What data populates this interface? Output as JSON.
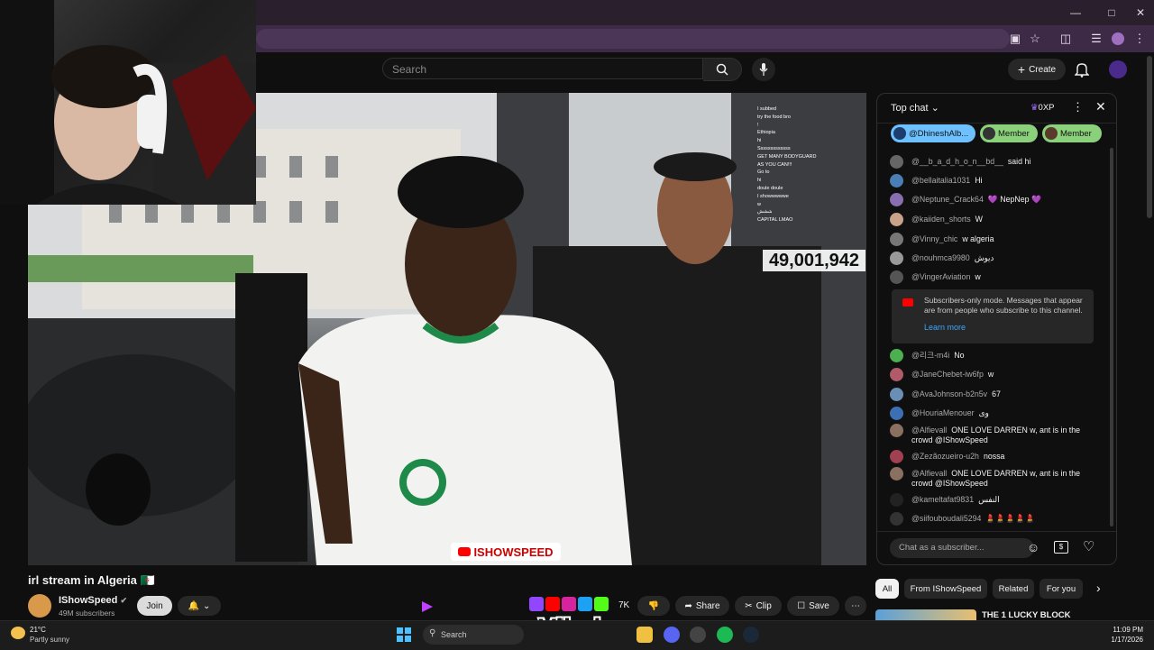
{
  "search": {
    "placeholder": "Search"
  },
  "header": {
    "create_label": "Create"
  },
  "video": {
    "counter": "49,001,942",
    "watermark": "ISHOWSPEED",
    "overlay_chat": [
      "I subbed",
      "try the food bro",
      "!",
      "Ethiopia",
      "hi",
      "Sssssssssssss",
      "",
      "GET MANY BODYGUARD",
      "AS YOU CAN!!!",
      "Go to",
      "hi",
      "doule doule",
      "I showwwwwe",
      "w",
      "ششش",
      "CAPITAL LMAO"
    ]
  },
  "chat": {
    "mode_label": "Top chat",
    "xp_label": "0XP",
    "pills": [
      "@DhineshAlb...",
      "Member",
      "Member"
    ],
    "messages": [
      {
        "author": "@__b_a_d_h_o_n__bd__",
        "text": "said hi",
        "color": "#666"
      },
      {
        "author": "@bellaitalia1031",
        "text": "Hi",
        "color": "#4a7fb5"
      },
      {
        "author": "@Neptune_Crack64",
        "text": "💜 NepNep 💜",
        "color": "#8a6fb0"
      },
      {
        "author": "@kaiiden_shorts",
        "text": "W",
        "color": "#c9a28c"
      },
      {
        "author": "@Vinny_chic",
        "text": "w algeria",
        "color": "#777"
      },
      {
        "author": "@nouhmca9980",
        "text": "ديوش",
        "color": "#999"
      },
      {
        "author": "@VingerAviation",
        "text": "w",
        "color": "#555"
      },
      {
        "author": "@리크-m4i",
        "text": "No",
        "color": "#4caf50"
      },
      {
        "author": "@JaneChebet-iw6fp",
        "text": "w",
        "color": "#b05a6a"
      },
      {
        "author": "@AvaJohnson-b2n5v",
        "text": "67",
        "color": "#6a8fb5"
      },
      {
        "author": "@HouriaMenouer",
        "text": "وى",
        "color": "#3d6fb5"
      },
      {
        "author": "@Alfievall",
        "text": "ONE LOVE DARREN w, ant is in the crowd @IShowSpeed",
        "color": "#8a7060"
      },
      {
        "author": "@Zezãozueiro-u2h",
        "text": "nossa",
        "color": "#a04050"
      },
      {
        "author": "@Alfievall",
        "text": "ONE LOVE DARREN w, ant is in the crowd @IShowSpeed",
        "color": "#8a7060"
      },
      {
        "author": "@kameltafat9831",
        "text": "النفس",
        "color": "#222"
      },
      {
        "author": "@siifouboudali5294",
        "text": "💄💄💄💄💄",
        "color": "#333"
      }
    ],
    "system_message": "Subscribers-only mode. Messages that appear are from people who subscribe to this channel.",
    "learn_more": "Learn more",
    "input_placeholder": "Chat as a subscriber..."
  },
  "below": {
    "title": "irl stream in Algeria 🇩🇿",
    "channel_name": "IShowSpeed",
    "subscribers": "49M subscribers",
    "join_label": "Join",
    "likes": "7K",
    "share_label": "Share",
    "clip_label": "Clip",
    "save_label": "Save",
    "logo_text": "Vibzlo"
  },
  "chips": [
    "All",
    "From IShowSpeed",
    "Related",
    "For you"
  ],
  "recommended": {
    "title": "THE 1 LUCKY BLOCK"
  },
  "taskbar": {
    "temperature": "21°C",
    "weather": "Partly sunny",
    "search_placeholder": "Search",
    "time": "11:09 PM",
    "date": "1/17/2026"
  },
  "colors": {
    "accent": "#3ea6ff",
    "chrome": "#3c2a47",
    "pill_green": "#8bd17c",
    "pill_blue": "#6ec1ff"
  }
}
